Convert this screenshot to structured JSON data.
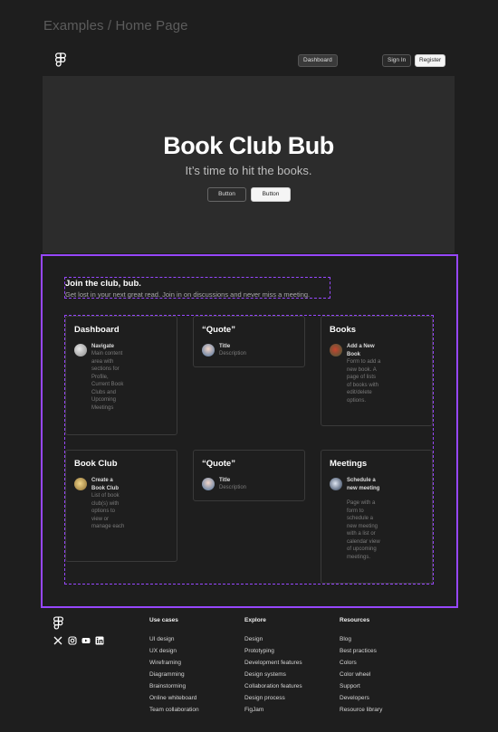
{
  "breadcrumb": "Examples / Home Page",
  "nav": {
    "dashboard": "Dashboard",
    "sign_in": "Sign In",
    "register": "Register"
  },
  "hero": {
    "title": "Book Club Bub",
    "subtitle": "It’s time to hit the books.",
    "button1": "Button",
    "button2": "Button"
  },
  "intro": {
    "title": "Join the club, bub.",
    "text": "Get lost in your next great read.  Join in on discussions and never miss a meeting."
  },
  "cards": [
    {
      "title": "Dashboard",
      "item_title": "Navigate",
      "item_desc": "Main content area with sections for Profile, Current Book Clubs and Upcoming Meetings"
    },
    {
      "title": "“Quote”",
      "item_title": "Title",
      "item_desc": "Description"
    },
    {
      "title": "Books",
      "item_title": "Add a New Book",
      "item_desc": "Form to add a new book.  A page of lists of books with edit/delete options."
    },
    {
      "title": "Book Club",
      "item_title": "Create a Book Club",
      "item_desc": "List of book club(s) with options to view or manage each"
    },
    {
      "title": "“Quote”",
      "item_title": "Title",
      "item_desc": "Description"
    },
    {
      "title": "Meetings",
      "item_title": "Schedule a new meeting",
      "item_desc": "Page with a form to schedule a new meeting with a list or calendar view of upcoming meetings."
    }
  ],
  "footer": {
    "columns": [
      {
        "title": "Use cases",
        "links": [
          "UI design",
          "UX design",
          "Wireframing",
          "Diagramming",
          "Brainstorming",
          "Online whiteboard",
          "Team collaboration"
        ]
      },
      {
        "title": "Explore",
        "links": [
          "Design",
          "Prototyping",
          "Development features",
          "Design systems",
          "Collaboration features",
          "Design process",
          "FigJam"
        ]
      },
      {
        "title": "Resources",
        "links": [
          "Blog",
          "Best practices",
          "Colors",
          "Color wheel",
          "Support",
          "Developers",
          "Resource library"
        ]
      }
    ],
    "social_icons": [
      "x-icon",
      "instagram-icon",
      "youtube-icon",
      "linkedin-icon"
    ]
  },
  "colors": {
    "accent": "#9747ff",
    "background": "#1e1e1e",
    "hero_bg": "#2c2c2c"
  }
}
